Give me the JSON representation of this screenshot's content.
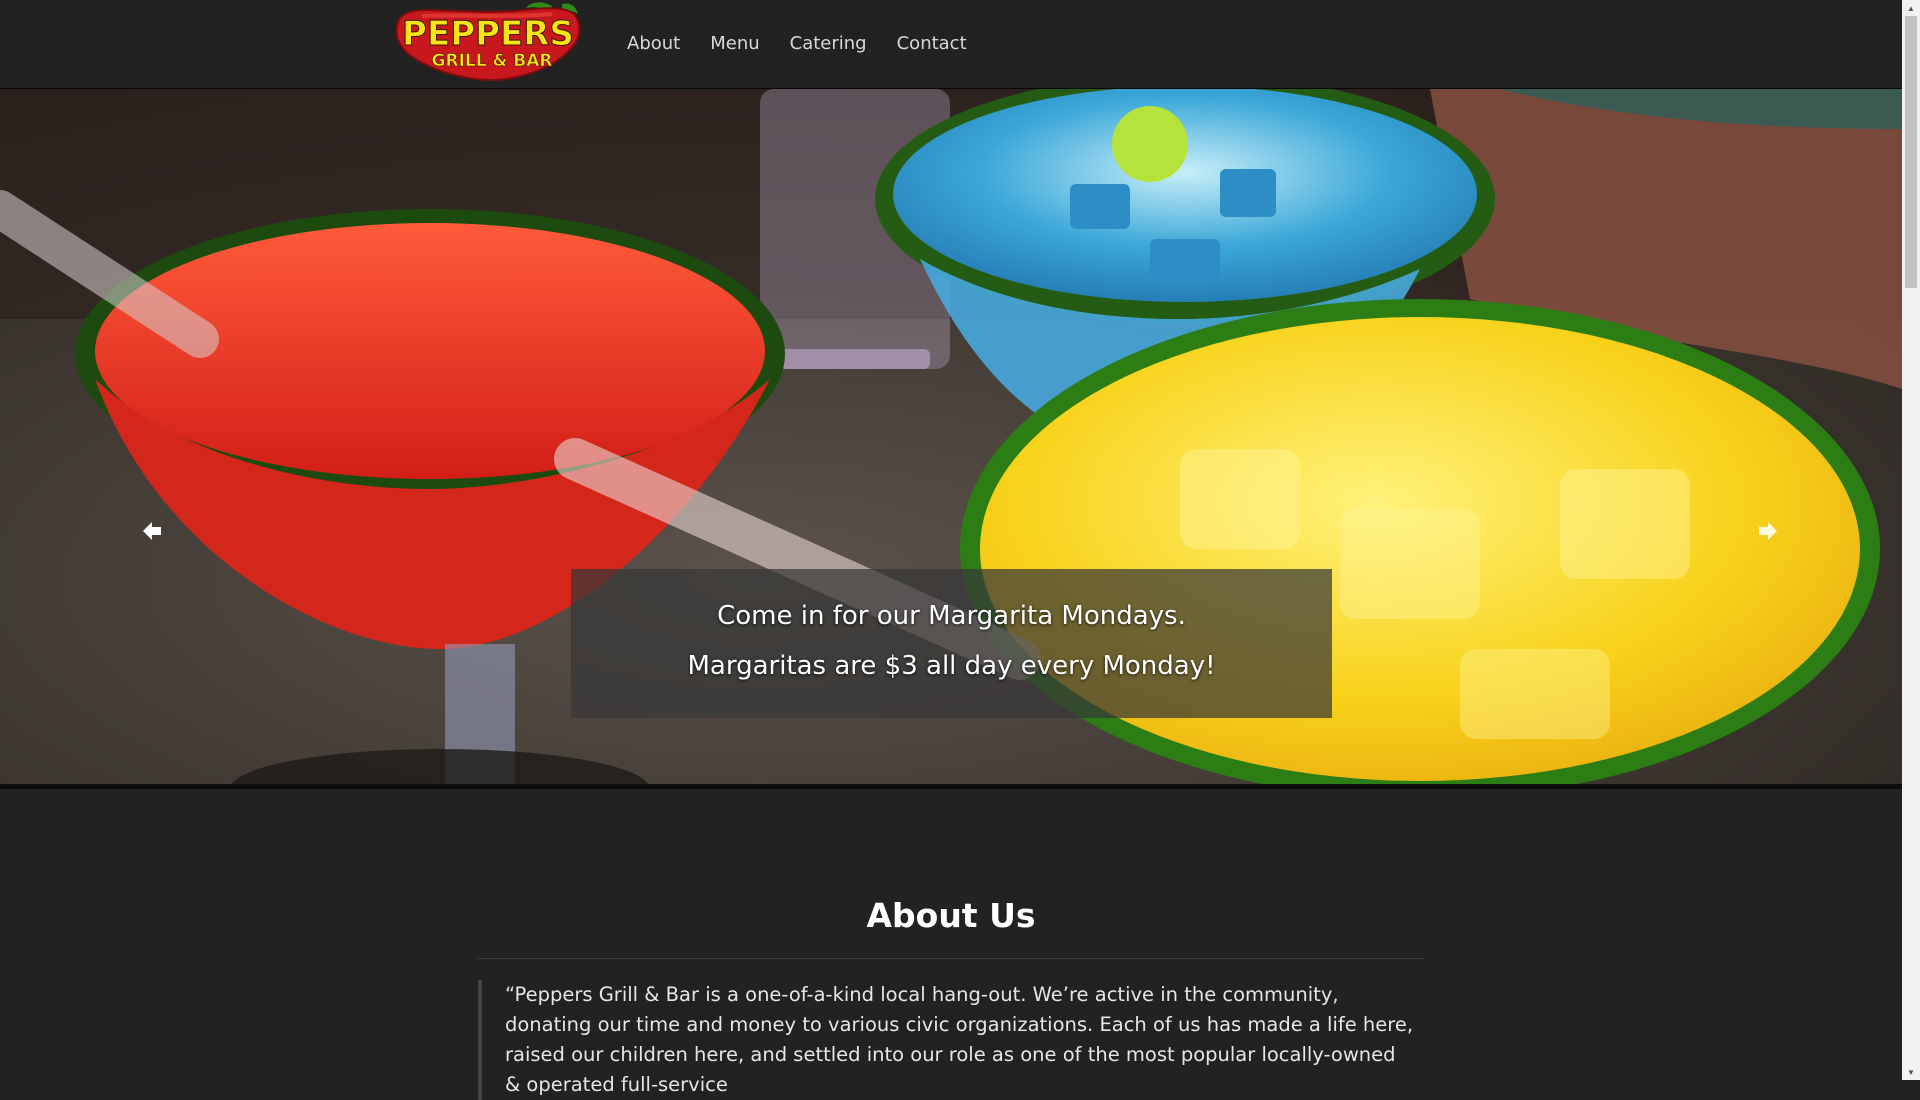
{
  "brand": {
    "name": "PEPPERS",
    "tagline": "GRILL & BAR",
    "colors": {
      "pepper_red": "#c8181e",
      "text_yellow": "#f7e319",
      "stem_green": "#2f8a1c"
    }
  },
  "nav": {
    "items": [
      {
        "label": "About"
      },
      {
        "label": "Menu"
      },
      {
        "label": "Catering"
      },
      {
        "label": "Contact"
      }
    ]
  },
  "carousel": {
    "caption_line1": "Come in for our Margarita Mondays.",
    "caption_line2": "Margaritas are $3 all day every Monday!",
    "prev_icon": "arrow-left-icon",
    "next_icon": "arrow-right-icon"
  },
  "about": {
    "title": "About Us",
    "quote": "“Peppers Grill & Bar is a one-of-a-kind local hang-out. We’re active in the community, donating our time and money to various civic organizations. Each of us has made a life here, raised our children here, and settled into our role as one of the most popular locally-owned & operated full-service"
  },
  "theme": {
    "background": "#222222",
    "nav_text": "#d8d8d8"
  }
}
